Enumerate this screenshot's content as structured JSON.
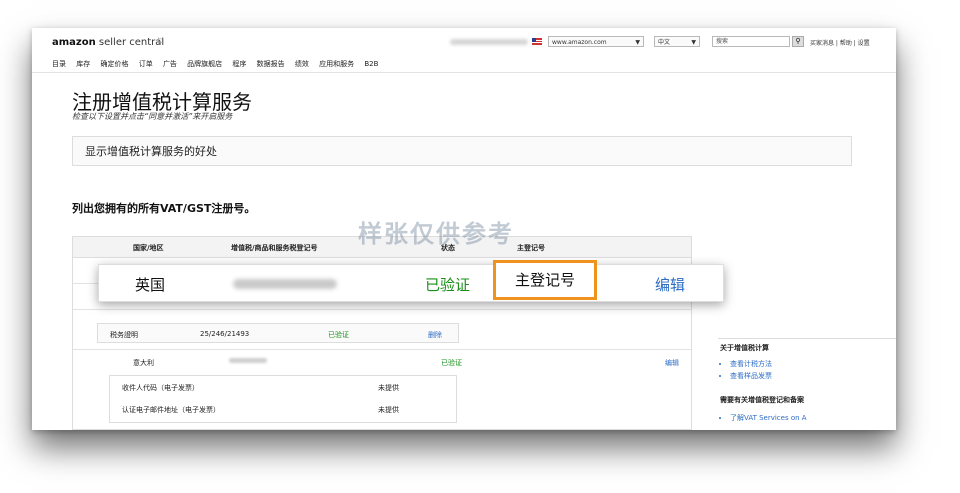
{
  "topbar": {
    "logo_bold": "amazon",
    "logo_rest": " seller central",
    "flag_icon": "flag-icon",
    "nav": [
      "目录",
      "库存",
      "确定价格",
      "订单",
      "广告",
      "品牌旗舰店",
      "程序",
      "数据报告",
      "绩效",
      "应用和服务",
      "B2B"
    ],
    "marketplace": "www.amazon.com",
    "language": "中文",
    "search_placeholder": "搜索",
    "links": "买家消息 | 帮助 | 设置"
  },
  "page": {
    "title": "注册增值税计算服务",
    "subtitle": "检查以下设置并点击“同意并激活”来开启服务",
    "benefits_label": "显示增值税计算服务的好处",
    "section_heading": "列出您拥有的所有VAT/GST注册号。",
    "watermark": "样张仅供参考"
  },
  "table": {
    "headers": [
      "国家/地区",
      "增值税/商品和服务税登记号",
      "状态",
      "主登记号"
    ],
    "tax_row": {
      "label": "税务證明",
      "number": "25/246/21493",
      "status": "已验证",
      "action": "删除"
    },
    "italy_row": {
      "country": "意大利",
      "status": "已验证",
      "action": "编辑"
    },
    "info_rows": [
      {
        "label": "收件人代码（电子发票）",
        "value": "未提供"
      },
      {
        "label": "认证电子邮件地址（电子发票）",
        "value": "未提供"
      }
    ]
  },
  "callout": {
    "country": "英国",
    "status": "已验证",
    "primary": "主登记号",
    "action": "编辑"
  },
  "right_panel": {
    "heading1": "关于增值税计算",
    "links1": [
      "查看计税方法",
      "查看样品发票"
    ],
    "heading2": "需要有关增值税登记和备案",
    "links2": [
      "了解VAT Services on A"
    ]
  },
  "colors": {
    "verified": "#1a8f1a",
    "link": "#2d6cc4",
    "highlight": "#f0921e"
  }
}
